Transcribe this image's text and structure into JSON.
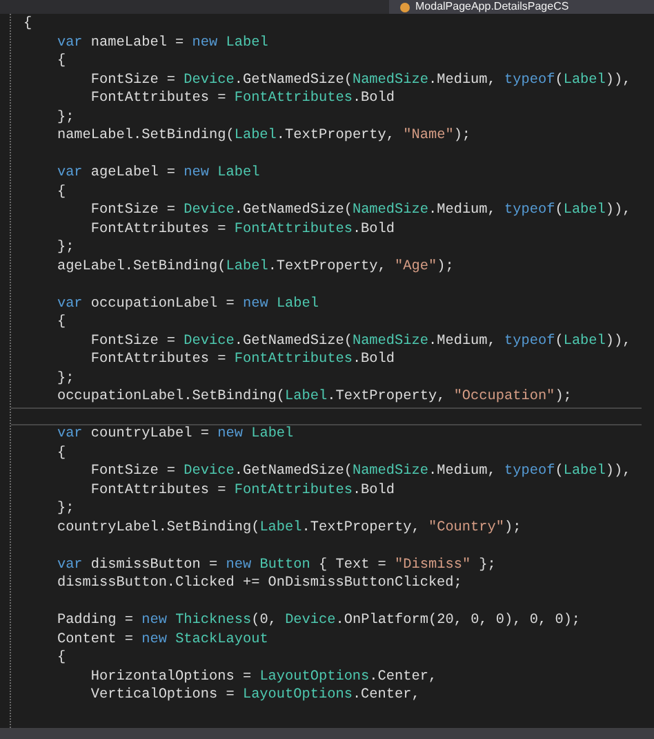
{
  "tab": {
    "title": "ModalPageApp.DetailsPageCS"
  },
  "lines": [
    {
      "current": false,
      "tokens": [
        {
          "kind": "plain",
          "text": "{"
        }
      ]
    },
    {
      "current": false,
      "tokens": [
        {
          "kind": "keyword",
          "text": "    var"
        },
        {
          "kind": "plain",
          "text": " nameLabel = "
        },
        {
          "kind": "keyword",
          "text": "new "
        },
        {
          "kind": "type",
          "text": "Label"
        }
      ]
    },
    {
      "current": false,
      "tokens": [
        {
          "kind": "plain",
          "text": "    {"
        }
      ]
    },
    {
      "current": false,
      "tokens": [
        {
          "kind": "plain",
          "text": "        FontSize = "
        },
        {
          "kind": "type",
          "text": "Device"
        },
        {
          "kind": "plain",
          "text": ".GetNamedSize("
        },
        {
          "kind": "type",
          "text": "NamedSize"
        },
        {
          "kind": "plain",
          "text": ".Medium, "
        },
        {
          "kind": "keyword",
          "text": "typeof"
        },
        {
          "kind": "plain",
          "text": "("
        },
        {
          "kind": "type",
          "text": "Label"
        },
        {
          "kind": "plain",
          "text": ")),"
        }
      ]
    },
    {
      "current": false,
      "tokens": [
        {
          "kind": "plain",
          "text": "        FontAttributes = "
        },
        {
          "kind": "type",
          "text": "FontAttributes"
        },
        {
          "kind": "plain",
          "text": ".Bold"
        }
      ]
    },
    {
      "current": false,
      "tokens": [
        {
          "kind": "plain",
          "text": "    };"
        }
      ]
    },
    {
      "current": false,
      "tokens": [
        {
          "kind": "plain",
          "text": "    nameLabel.SetBinding("
        },
        {
          "kind": "type",
          "text": "Label"
        },
        {
          "kind": "plain",
          "text": ".TextProperty, "
        },
        {
          "kind": "string",
          "text": "\"Name\""
        },
        {
          "kind": "plain",
          "text": ");"
        }
      ]
    },
    {
      "current": false
    },
    {
      "current": false,
      "tokens": [
        {
          "kind": "keyword",
          "text": "    var"
        },
        {
          "kind": "plain",
          "text": " ageLabel = "
        },
        {
          "kind": "keyword",
          "text": "new "
        },
        {
          "kind": "type",
          "text": "Label"
        }
      ]
    },
    {
      "current": false,
      "tokens": [
        {
          "kind": "plain",
          "text": "    {"
        }
      ]
    },
    {
      "current": false,
      "tokens": [
        {
          "kind": "plain",
          "text": "        FontSize = "
        },
        {
          "kind": "type",
          "text": "Device"
        },
        {
          "kind": "plain",
          "text": ".GetNamedSize("
        },
        {
          "kind": "type",
          "text": "NamedSize"
        },
        {
          "kind": "plain",
          "text": ".Medium, "
        },
        {
          "kind": "keyword",
          "text": "typeof"
        },
        {
          "kind": "plain",
          "text": "("
        },
        {
          "kind": "type",
          "text": "Label"
        },
        {
          "kind": "plain",
          "text": ")),"
        }
      ]
    },
    {
      "current": false,
      "tokens": [
        {
          "kind": "plain",
          "text": "        FontAttributes = "
        },
        {
          "kind": "type",
          "text": "FontAttributes"
        },
        {
          "kind": "plain",
          "text": ".Bold"
        }
      ]
    },
    {
      "current": false,
      "tokens": [
        {
          "kind": "plain",
          "text": "    };"
        }
      ]
    },
    {
      "current": false,
      "tokens": [
        {
          "kind": "plain",
          "text": "    ageLabel.SetBinding("
        },
        {
          "kind": "type",
          "text": "Label"
        },
        {
          "kind": "plain",
          "text": ".TextProperty, "
        },
        {
          "kind": "string",
          "text": "\"Age\""
        },
        {
          "kind": "plain",
          "text": ");"
        }
      ]
    },
    {
      "current": false
    },
    {
      "current": false,
      "tokens": [
        {
          "kind": "keyword",
          "text": "    var"
        },
        {
          "kind": "plain",
          "text": " occupationLabel = "
        },
        {
          "kind": "keyword",
          "text": "new "
        },
        {
          "kind": "type",
          "text": "Label"
        }
      ]
    },
    {
      "current": false,
      "tokens": [
        {
          "kind": "plain",
          "text": "    {"
        }
      ]
    },
    {
      "current": false,
      "tokens": [
        {
          "kind": "plain",
          "text": "        FontSize = "
        },
        {
          "kind": "type",
          "text": "Device"
        },
        {
          "kind": "plain",
          "text": ".GetNamedSize("
        },
        {
          "kind": "type",
          "text": "NamedSize"
        },
        {
          "kind": "plain",
          "text": ".Medium, "
        },
        {
          "kind": "keyword",
          "text": "typeof"
        },
        {
          "kind": "plain",
          "text": "("
        },
        {
          "kind": "type",
          "text": "Label"
        },
        {
          "kind": "plain",
          "text": ")),"
        }
      ]
    },
    {
      "current": false,
      "tokens": [
        {
          "kind": "plain",
          "text": "        FontAttributes = "
        },
        {
          "kind": "type",
          "text": "FontAttributes"
        },
        {
          "kind": "plain",
          "text": ".Bold"
        }
      ]
    },
    {
      "current": false,
      "tokens": [
        {
          "kind": "plain",
          "text": "    };"
        }
      ]
    },
    {
      "current": false,
      "tokens": [
        {
          "kind": "plain",
          "text": "    occupationLabel.SetBinding("
        },
        {
          "kind": "type",
          "text": "Label"
        },
        {
          "kind": "plain",
          "text": ".TextProperty, "
        },
        {
          "kind": "string",
          "text": "\"Occupation\""
        },
        {
          "kind": "plain",
          "text": ");"
        }
      ]
    },
    {
      "current": true
    },
    {
      "current": false,
      "tokens": [
        {
          "kind": "keyword",
          "text": "    var"
        },
        {
          "kind": "plain",
          "text": " countryLabel = "
        },
        {
          "kind": "keyword",
          "text": "new "
        },
        {
          "kind": "type",
          "text": "Label"
        }
      ]
    },
    {
      "current": false,
      "tokens": [
        {
          "kind": "plain",
          "text": "    {"
        }
      ]
    },
    {
      "current": false,
      "tokens": [
        {
          "kind": "plain",
          "text": "        FontSize = "
        },
        {
          "kind": "type",
          "text": "Device"
        },
        {
          "kind": "plain",
          "text": ".GetNamedSize("
        },
        {
          "kind": "type",
          "text": "NamedSize"
        },
        {
          "kind": "plain",
          "text": ".Medium, "
        },
        {
          "kind": "keyword",
          "text": "typeof"
        },
        {
          "kind": "plain",
          "text": "("
        },
        {
          "kind": "type",
          "text": "Label"
        },
        {
          "kind": "plain",
          "text": ")),"
        }
      ]
    },
    {
      "current": false,
      "tokens": [
        {
          "kind": "plain",
          "text": "        FontAttributes = "
        },
        {
          "kind": "type",
          "text": "FontAttributes"
        },
        {
          "kind": "plain",
          "text": ".Bold"
        }
      ]
    },
    {
      "current": false,
      "tokens": [
        {
          "kind": "plain",
          "text": "    };"
        }
      ]
    },
    {
      "current": false,
      "tokens": [
        {
          "kind": "plain",
          "text": "    countryLabel.SetBinding("
        },
        {
          "kind": "type",
          "text": "Label"
        },
        {
          "kind": "plain",
          "text": ".TextProperty, "
        },
        {
          "kind": "string",
          "text": "\"Country\""
        },
        {
          "kind": "plain",
          "text": ");"
        }
      ]
    },
    {
      "current": false
    },
    {
      "current": false,
      "tokens": [
        {
          "kind": "keyword",
          "text": "    var"
        },
        {
          "kind": "plain",
          "text": " dismissButton = "
        },
        {
          "kind": "keyword",
          "text": "new "
        },
        {
          "kind": "type",
          "text": "Button"
        },
        {
          "kind": "plain",
          "text": " { Text = "
        },
        {
          "kind": "string",
          "text": "\"Dismiss\""
        },
        {
          "kind": "plain",
          "text": " };"
        }
      ]
    },
    {
      "current": false,
      "tokens": [
        {
          "kind": "plain",
          "text": "    dismissButton.Clicked += OnDismissButtonClicked;"
        }
      ]
    },
    {
      "current": false
    },
    {
      "current": false,
      "tokens": [
        {
          "kind": "plain",
          "text": "    Padding = "
        },
        {
          "kind": "keyword",
          "text": "new "
        },
        {
          "kind": "type",
          "text": "Thickness"
        },
        {
          "kind": "plain",
          "text": "(0, "
        },
        {
          "kind": "type",
          "text": "Device"
        },
        {
          "kind": "plain",
          "text": ".OnPlatform(20, 0, 0), 0, 0);"
        }
      ]
    },
    {
      "current": false,
      "tokens": [
        {
          "kind": "plain",
          "text": "    Content = "
        },
        {
          "kind": "keyword",
          "text": "new "
        },
        {
          "kind": "type",
          "text": "StackLayout"
        }
      ]
    },
    {
      "current": false,
      "tokens": [
        {
          "kind": "plain",
          "text": "    {"
        }
      ]
    },
    {
      "current": false,
      "tokens": [
        {
          "kind": "plain",
          "text": "        HorizontalOptions = "
        },
        {
          "kind": "type",
          "text": "LayoutOptions"
        },
        {
          "kind": "plain",
          "text": ".Center,"
        }
      ]
    },
    {
      "current": false,
      "tokens": [
        {
          "kind": "plain",
          "text": "        VerticalOptions = "
        },
        {
          "kind": "type",
          "text": "LayoutOptions"
        },
        {
          "kind": "plain",
          "text": ".Center,"
        }
      ]
    }
  ]
}
